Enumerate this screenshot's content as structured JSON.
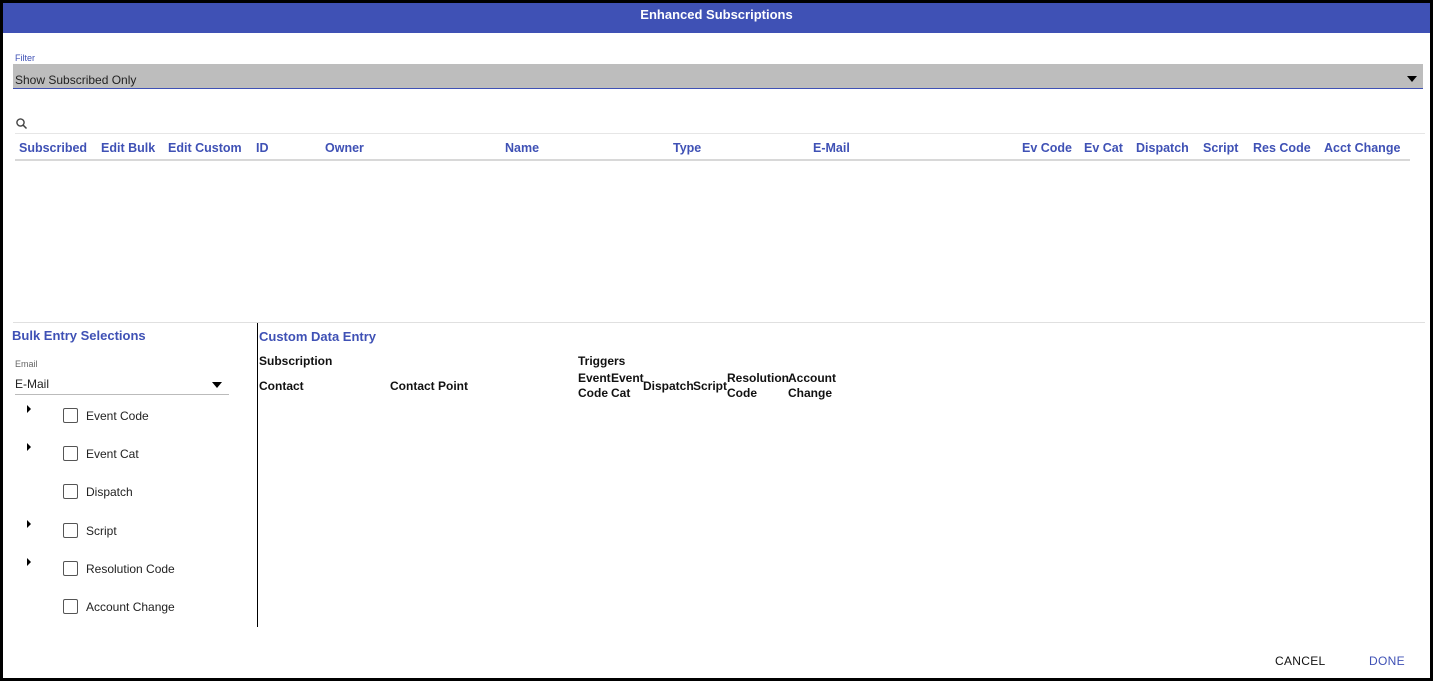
{
  "dialog": {
    "title": "Enhanced Subscriptions"
  },
  "filter": {
    "label": "Filter",
    "value": "Show Subscribed Only"
  },
  "grid": {
    "columns": [
      "Subscribed",
      "Edit Bulk",
      "Edit Custom",
      "ID",
      "Owner",
      "Name",
      "Type",
      "E-Mail",
      "Ev Code",
      "Ev Cat",
      "Dispatch",
      "Script",
      "Res Code",
      "Acct Change"
    ],
    "rows": []
  },
  "bulk": {
    "title": "Bulk Entry Selections",
    "email_label": "Email",
    "email_value": "E-Mail",
    "items": [
      {
        "label": "Event Code",
        "expandable": true,
        "checked": false
      },
      {
        "label": "Event Cat",
        "expandable": true,
        "checked": false
      },
      {
        "label": "Dispatch",
        "expandable": false,
        "checked": false
      },
      {
        "label": "Script",
        "expandable": true,
        "checked": false
      },
      {
        "label": "Resolution Code",
        "expandable": true,
        "checked": false
      },
      {
        "label": "Account Change",
        "expandable": false,
        "checked": false
      }
    ]
  },
  "custom": {
    "title": "Custom Data Entry",
    "subscription_header": "Subscription",
    "triggers_header": "Triggers",
    "contact": "Contact",
    "contact_point": "Contact Point",
    "event_code": "Event Code",
    "event_cat": "Event Cat",
    "dispatch": "Dispatch",
    "script": "Script",
    "resolution_code": "Resolution Code",
    "account_change": "Account Change"
  },
  "actions": {
    "cancel": "CANCEL",
    "done": "DONE"
  },
  "colors": {
    "accent": "#3f51b5",
    "filter_bg": "#bdbdbd"
  }
}
